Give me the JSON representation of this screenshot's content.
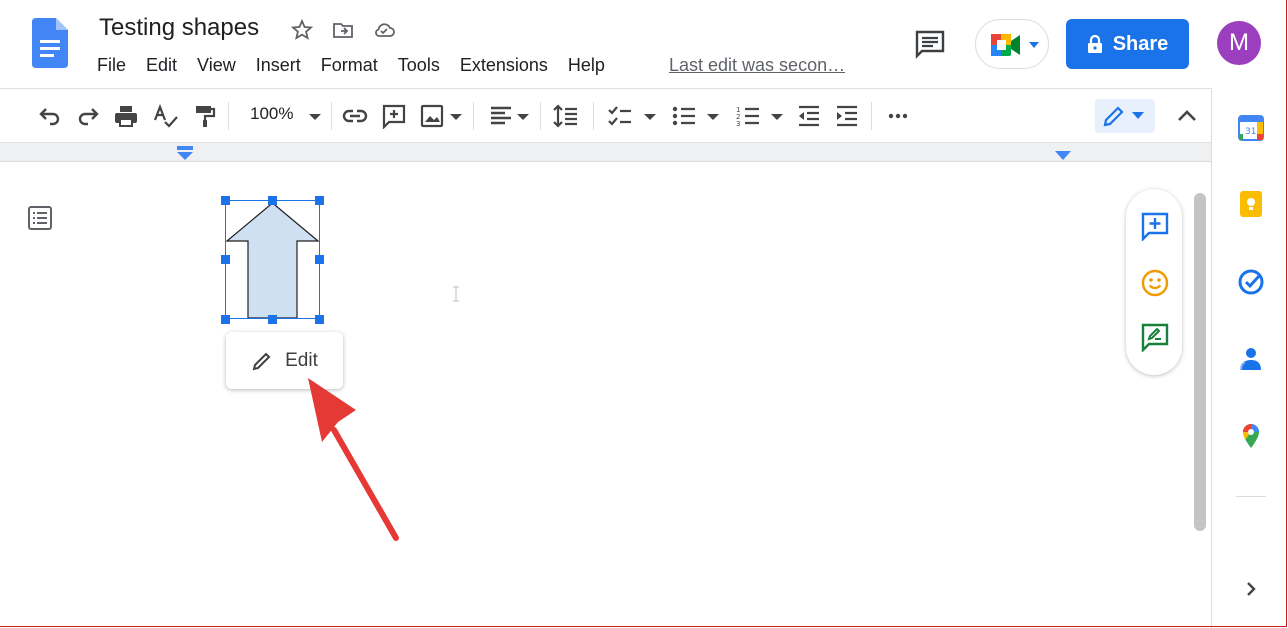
{
  "document": {
    "title": "Testing shapes",
    "last_edit": "Last edit was secon…"
  },
  "menu": {
    "items": [
      "File",
      "Edit",
      "View",
      "Insert",
      "Format",
      "Tools",
      "Extensions",
      "Help"
    ]
  },
  "header": {
    "share_label": "Share",
    "avatar_initial": "M"
  },
  "toolbar": {
    "zoom": "100%"
  },
  "shape": {
    "type": "up-arrow",
    "fill": "#cfe0f2",
    "stroke": "#202124"
  },
  "popup": {
    "edit_label": "Edit"
  },
  "colors": {
    "accent": "#1a73e8",
    "avatar": "#9c3fbf",
    "annotation_arrow": "#e53935"
  }
}
